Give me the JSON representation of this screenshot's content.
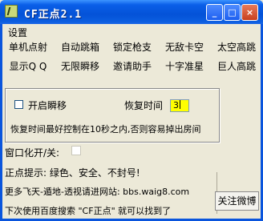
{
  "window": {
    "title": "CF正点2.1",
    "minimize_glyph": "_",
    "maximize_glyph": "□",
    "close_glyph": "×"
  },
  "menu": {
    "settings": "设置"
  },
  "buttons_row1": [
    "单机点射",
    "自动跳箱",
    "锁定枪支",
    "无敌卡空",
    "太空高跳"
  ],
  "buttons_row2": [
    "显示Q Q",
    "无限瞬移",
    "邀请助手",
    "十字准星",
    "巨人高跳"
  ],
  "teleport_panel": {
    "enable_label": "开启瞬移",
    "enable_checked": false,
    "recover_time_label": "恢复时间",
    "recover_time_value": "3",
    "hint": "恢复时间最好控制在10秒之内,否则容易掉出房间"
  },
  "window_mode": {
    "label": "窗口化开/关:",
    "checked": false
  },
  "info": {
    "tip": "正点提示: 绿色、安全、不封号!",
    "more": "更多飞天-遁地-透视请进网站: bbs.waig8.com",
    "search": "下次使用百度搜索 \"CF正点\" 就可以找到了"
  },
  "follow_weibo": "关注微博"
}
